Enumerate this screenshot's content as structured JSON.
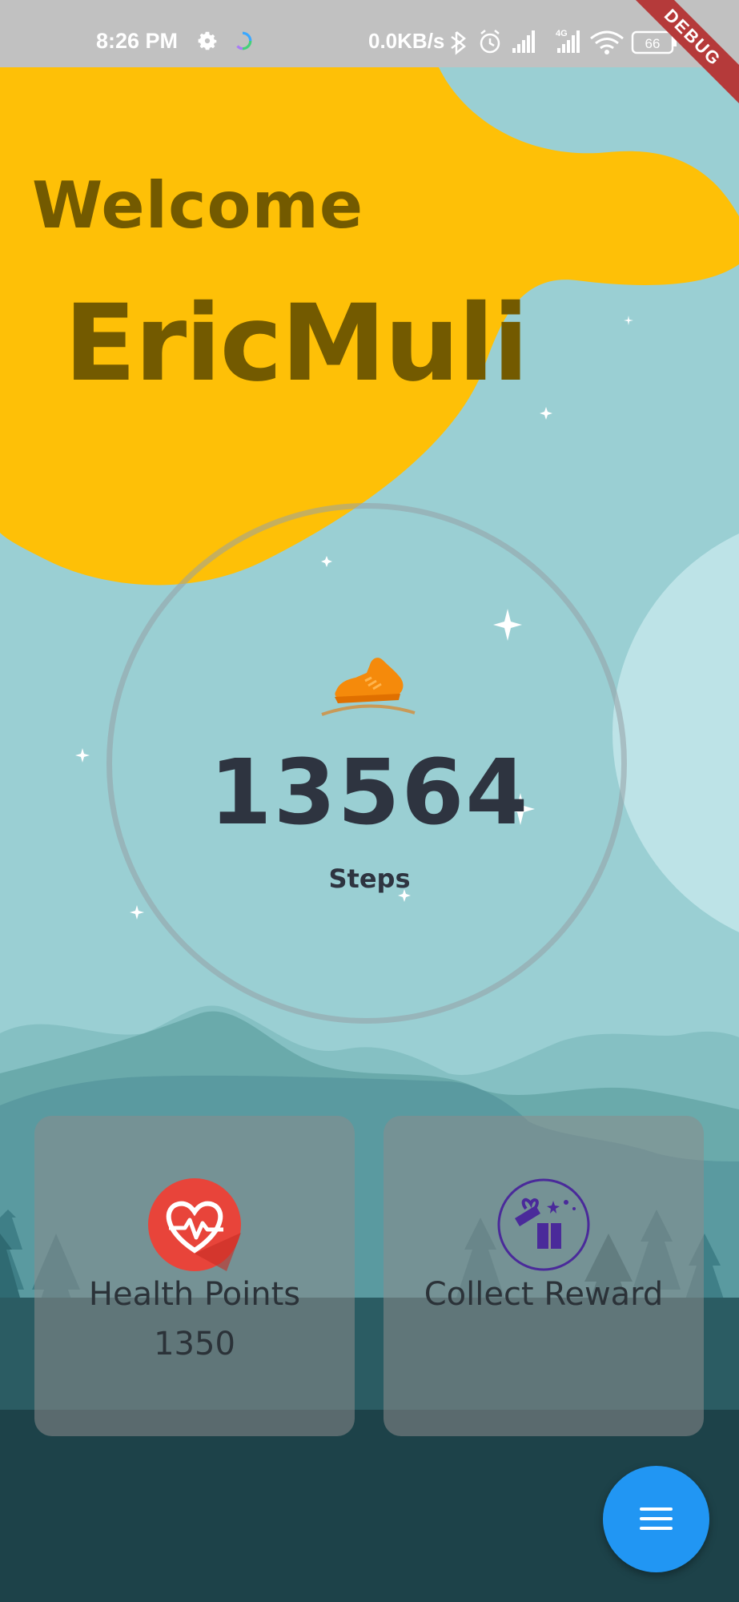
{
  "status_bar": {
    "time": "8:26 PM",
    "network_speed": "0.0KB/s",
    "signal_label": "4G",
    "battery": "66",
    "icons": [
      "gear-icon",
      "app-activity-icon",
      "bluetooth-icon",
      "alarm-icon",
      "signal-icon",
      "signal-4g-icon",
      "wifi-icon",
      "battery-icon"
    ]
  },
  "debug_banner": "DEBUG",
  "header": {
    "greeting": "Welcome",
    "username": "EricMuli"
  },
  "steps": {
    "icon": "running-shoe-icon",
    "count": "13564",
    "label": "Steps"
  },
  "cards": {
    "health": {
      "icon": "heart-pulse-icon",
      "title": "Health Points",
      "value": "1350"
    },
    "reward": {
      "icon": "gift-icon",
      "title": "Collect Reward"
    }
  },
  "fab": {
    "icon": "menu-icon"
  },
  "colors": {
    "sky": "#9acfd3",
    "blob": "#fec007",
    "heading": "#735a00",
    "steps_text": "#2e3440",
    "fab": "#2196f3",
    "heart_badge": "#e8443a",
    "gift": "#4a2a9a"
  }
}
